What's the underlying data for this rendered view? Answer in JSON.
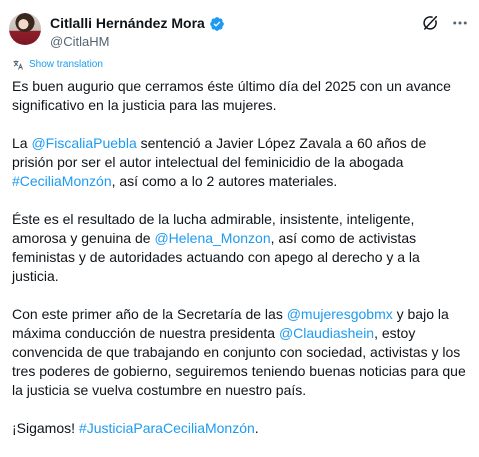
{
  "author": {
    "name": "Citlalli Hernández Mora",
    "handle": "@CitlaHM"
  },
  "translate_label": "Show translation",
  "paragraphs": {
    "p1": {
      "text": "Es buen augurio que cerramos éste último día del 2025 con un avance significativo en la justicia para las mujeres."
    },
    "p2": {
      "t1": "La ",
      "mention1": "@FiscaliaPuebla",
      "t2": " sentenció a Javier López Zavala a 60 años de prisión por ser el autor intelectual del feminicidio de la abogada ",
      "hashtag1": "#CeciliaMonzón",
      "t3": ", así como a lo 2 autores materiales."
    },
    "p3": {
      "t1": "Éste es el resultado de la lucha admirable, insistente, inteligente, amorosa y genuina de ",
      "mention1": "@Helena_Monzon",
      "t2": ", así como de activistas feministas y de autoridades actuando con apego al derecho y a la justicia."
    },
    "p4": {
      "t1": "Con este primer año de la Secretaría de las ",
      "mention1": "@mujeresgobmx",
      "t2": " y bajo la máxima conducción de nuestra presidenta ",
      "mention2": "@Claudiashein",
      "t3": ", estoy convencida de que trabajando en conjunto con sociedad, activistas y los tres poderes de gobierno, seguiremos teniendo buenas noticias para que la justicia se vuelva costumbre en nuestro país."
    },
    "p5": {
      "t1": "¡Sigamos! ",
      "hashtag1": "#JusticiaParaCeciliaMonzón",
      "t2": "."
    }
  },
  "icons": {
    "verified": "verified-badge-icon",
    "grok": "grok-icon",
    "more": "more-options-icon",
    "translate": "translate-icon"
  },
  "colors": {
    "link": "#1d9bf0",
    "text": "#0f1419",
    "secondary": "#536471"
  }
}
